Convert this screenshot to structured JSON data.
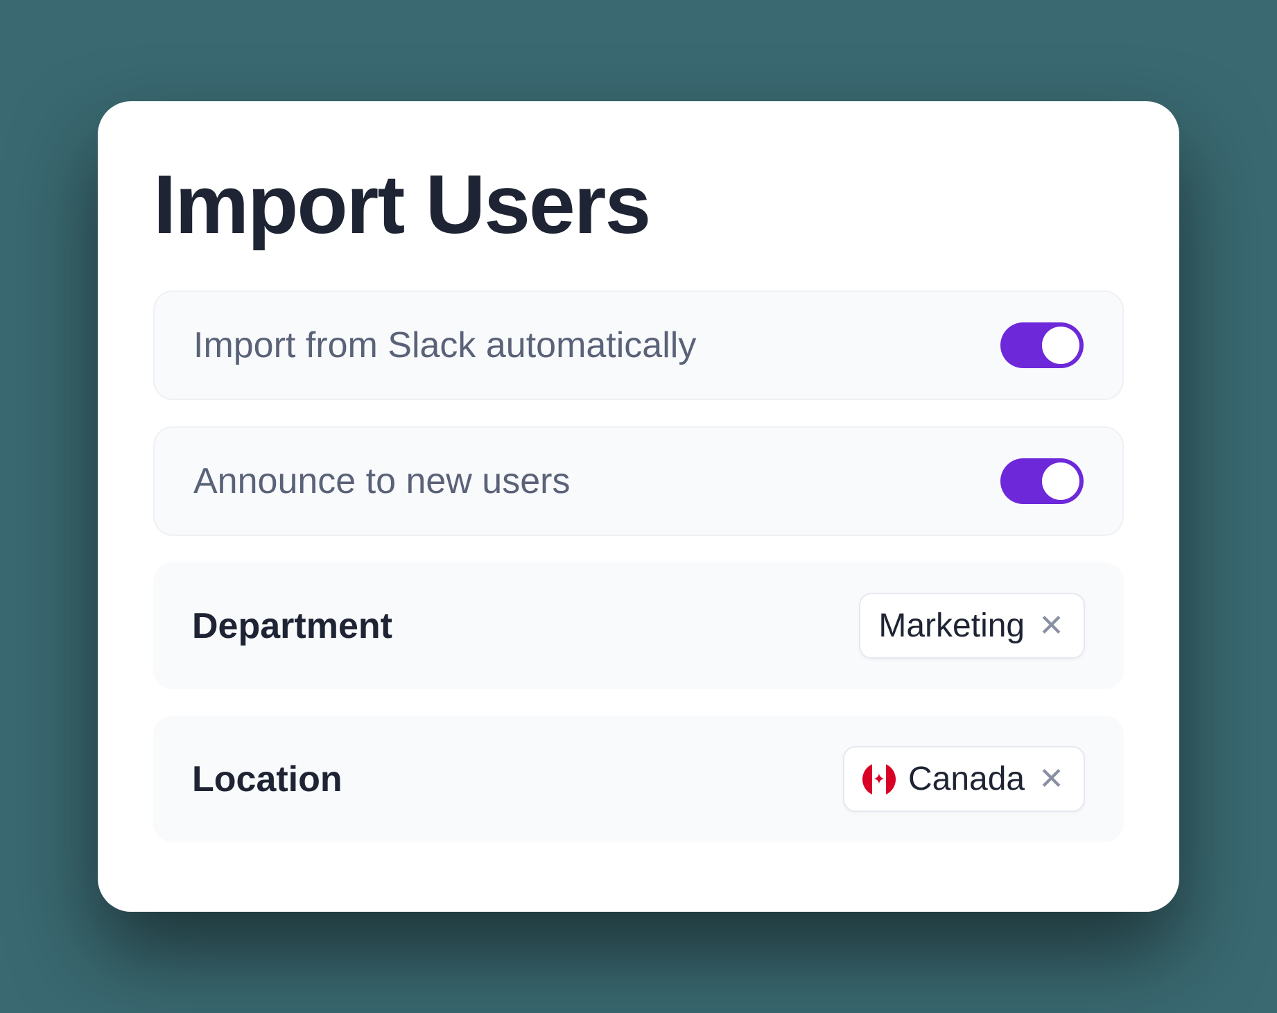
{
  "title": "Import Users",
  "settings": {
    "import_slack": {
      "label": "Import from Slack automatically",
      "enabled": true
    },
    "announce": {
      "label": "Announce to new users",
      "enabled": true
    }
  },
  "filters": {
    "department": {
      "label": "Department",
      "chip": "Marketing"
    },
    "location": {
      "label": "Location",
      "chip": "Canada",
      "flag": "canada"
    }
  },
  "colors": {
    "accent": "#6d28d9"
  }
}
